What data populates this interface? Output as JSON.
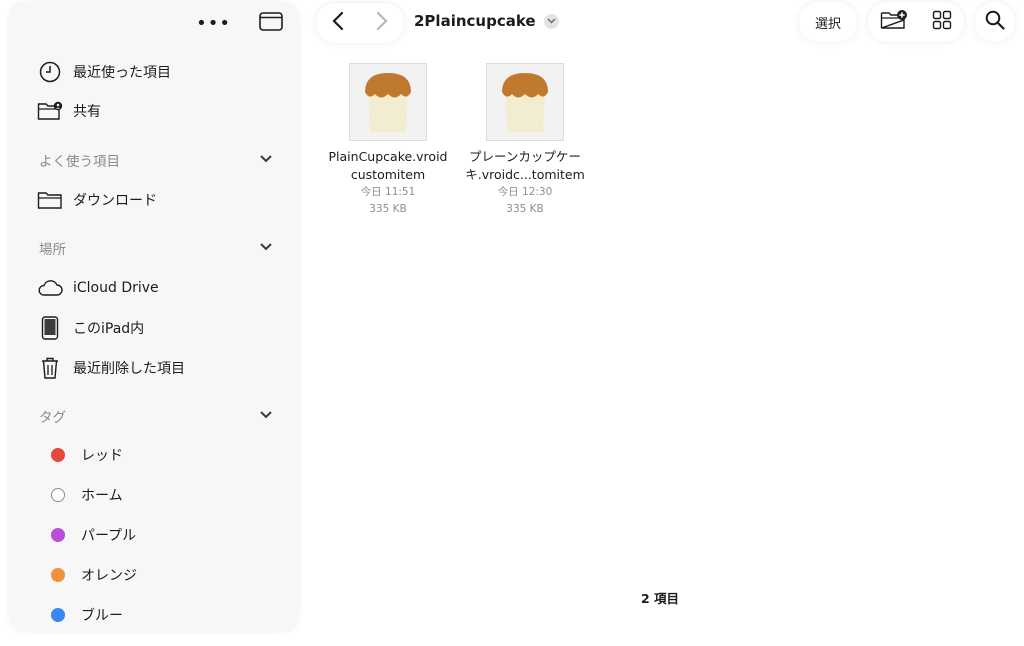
{
  "sidebar": {
    "recents_label": "最近使った項目",
    "shared_label": "共有",
    "favorites_header": "よく使う項目",
    "downloads_label": "ダウンロード",
    "locations_header": "場所",
    "icloud_label": "iCloud Drive",
    "ipad_label": "このiPad内",
    "deleted_label": "最近削除した項目",
    "tags_header": "タグ",
    "tags": [
      {
        "label": "レッド",
        "color": "#e5483e"
      },
      {
        "label": "ホーム",
        "color": "#ffffff"
      },
      {
        "label": "パープル",
        "color": "#b94fd6"
      },
      {
        "label": "オレンジ",
        "color": "#f0913e"
      },
      {
        "label": "ブルー",
        "color": "#3b86f0"
      }
    ]
  },
  "toolbar": {
    "folder_title": "2Plaincupcake",
    "select_label": "選択"
  },
  "files": [
    {
      "name_line1": "PlainCupcake.vroid",
      "name_line2": "customitem",
      "date": "今日 11:51",
      "size": "335 KB"
    },
    {
      "name_line1": "プレーンカップケー",
      "name_line2": "キ.vroidc...tomitem",
      "date": "今日 12:30",
      "size": "335 KB"
    }
  ],
  "item_count": "2 項目",
  "icons": {
    "more": "ellipsis-icon",
    "sidebar_toggle": "sidebar-toggle-icon",
    "back": "chevron-left-icon",
    "forward": "chevron-right-icon",
    "new_folder": "folder-plus-icon",
    "grid": "grid-icon",
    "search": "search-icon"
  }
}
